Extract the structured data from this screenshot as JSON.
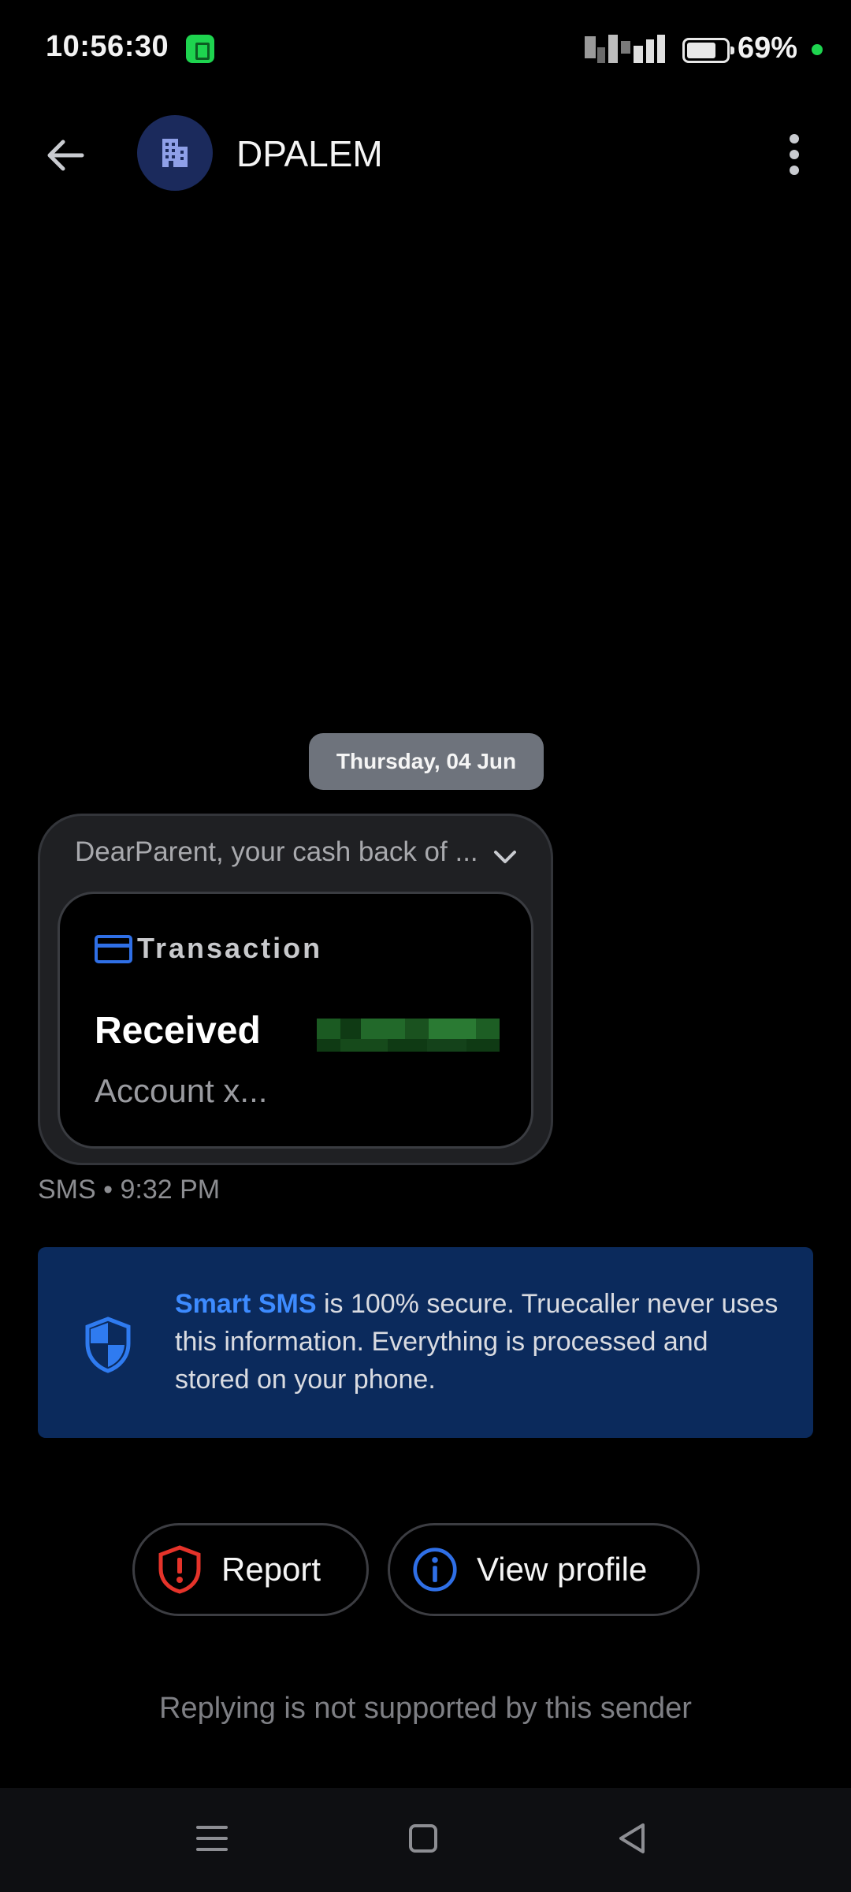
{
  "status_bar": {
    "time": "10:56:30",
    "battery_percent": "69%",
    "colors": {
      "app_icon": "#1ed44f",
      "dot": "#1ed44f"
    }
  },
  "header": {
    "sender": "DPALEM",
    "avatar_icon": "building-icon",
    "back_icon": "arrow-left-icon",
    "menu_icon": "more-vertical-icon"
  },
  "conversation": {
    "date_chip": "Thursday, 04 Jun",
    "message": {
      "preview": "DearParent, your cash back of ...",
      "card": {
        "icon": "credit-card-icon",
        "title": "Transaction",
        "status": "Received",
        "account": "Account x..."
      },
      "meta": "SMS • 9:32 PM"
    }
  },
  "info_banner": {
    "icon": "shield-icon",
    "highlight": "Smart SMS",
    "text": " is 100% secure. Truecaller never uses this information. Everything is processed and stored on your phone.",
    "colors": {
      "background": "#0b2a5c",
      "accent": "#3d8bff"
    }
  },
  "actions": {
    "report": {
      "label": "Report",
      "icon": "shield-alert-icon",
      "color": "#e5332a"
    },
    "view_profile": {
      "label": "View profile",
      "icon": "info-circle-icon",
      "color": "#2f6fe6"
    }
  },
  "footer_note": "Replying is not supported by this sender",
  "nav_bar": {
    "items": [
      "menu-icon",
      "home-square-icon",
      "back-triangle-icon"
    ]
  }
}
